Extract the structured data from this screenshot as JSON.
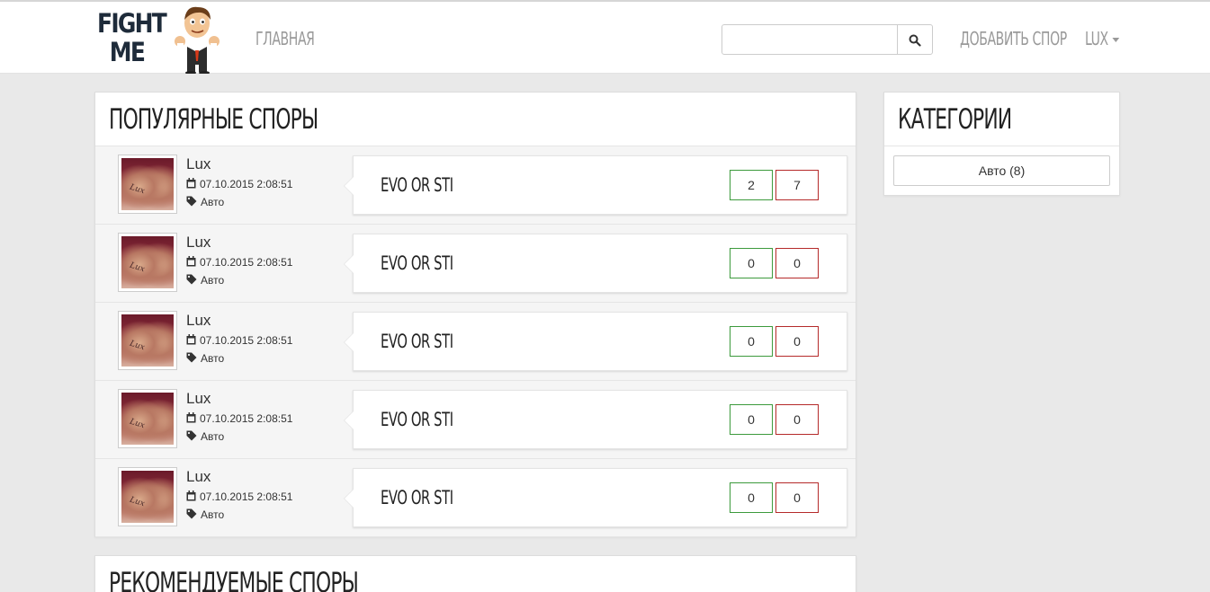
{
  "brand": {
    "line1": "FIGHT",
    "line2": "ME"
  },
  "nav": {
    "home": "ГЛАВНАЯ",
    "add_dispute": "ДОБАВИТЬ СПОР",
    "user": "LUX"
  },
  "search": {
    "value": "",
    "placeholder": ""
  },
  "popular": {
    "title": "ПОПУЛЯРНЫЕ СПОРЫ",
    "items": [
      {
        "author": "Lux",
        "date": "07.10.2015 2:08:51",
        "category": "Авто",
        "title": "EVO OR STI",
        "yes": "2",
        "no": "7"
      },
      {
        "author": "Lux",
        "date": "07.10.2015 2:08:51",
        "category": "Авто",
        "title": "EVO OR STI",
        "yes": "0",
        "no": "0"
      },
      {
        "author": "Lux",
        "date": "07.10.2015 2:08:51",
        "category": "Авто",
        "title": "EVO OR STI",
        "yes": "0",
        "no": "0"
      },
      {
        "author": "Lux",
        "date": "07.10.2015 2:08:51",
        "category": "Авто",
        "title": "EVO OR STI",
        "yes": "0",
        "no": "0"
      },
      {
        "author": "Lux",
        "date": "07.10.2015 2:08:51",
        "category": "Авто",
        "title": "EVO OR STI",
        "yes": "0",
        "no": "0"
      }
    ]
  },
  "recommended": {
    "title": "РЕКОМЕНДУЕМЫЕ СПОРЫ"
  },
  "categories": {
    "title": "КАТЕГОРИИ",
    "items": [
      "Авто (8)"
    ]
  },
  "avatar_signature": "Lux",
  "colors": {
    "vote_yes": "#3c9a3c",
    "vote_no": "#b52a2a",
    "background": "#e9e9e9"
  }
}
